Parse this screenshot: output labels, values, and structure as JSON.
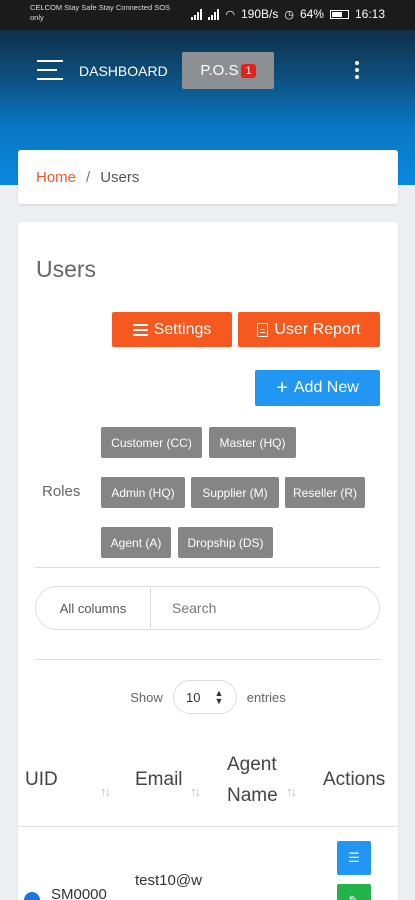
{
  "status_bar": {
    "carrier": "CELCOM Stay Safe Stay Connected SOS only",
    "speed": "190B/s",
    "battery": "64%",
    "time": "16:13"
  },
  "header": {
    "title": "DASHBOARD",
    "pos_label": "P.O.S",
    "pos_badge": "1"
  },
  "breadcrumb": {
    "home": "Home",
    "separator": "/",
    "current": "Users"
  },
  "page": {
    "title": "Users",
    "settings_label": "Settings",
    "report_label": "User Report",
    "add_label": "Add New"
  },
  "roles": {
    "label": "Roles",
    "items": [
      "Customer (CC)",
      "Master (HQ)",
      "Admin (HQ)",
      "Supplier (M)",
      "Reseller (R)",
      "Agent (A)",
      "Dropship (DS)"
    ]
  },
  "search": {
    "column_select": "All columns",
    "placeholder": "Search"
  },
  "entries": {
    "show": "Show",
    "value": "10",
    "suffix": "entries"
  },
  "table": {
    "columns": [
      "UID",
      "Email",
      "Agent Name",
      "Actions"
    ],
    "rows": [
      {
        "uid": "SM0000",
        "email": "test10@w"
      }
    ]
  },
  "colors": {
    "accent_orange": "#f5591f",
    "accent_blue": "#2196f3",
    "action_green": "#24b24b"
  }
}
